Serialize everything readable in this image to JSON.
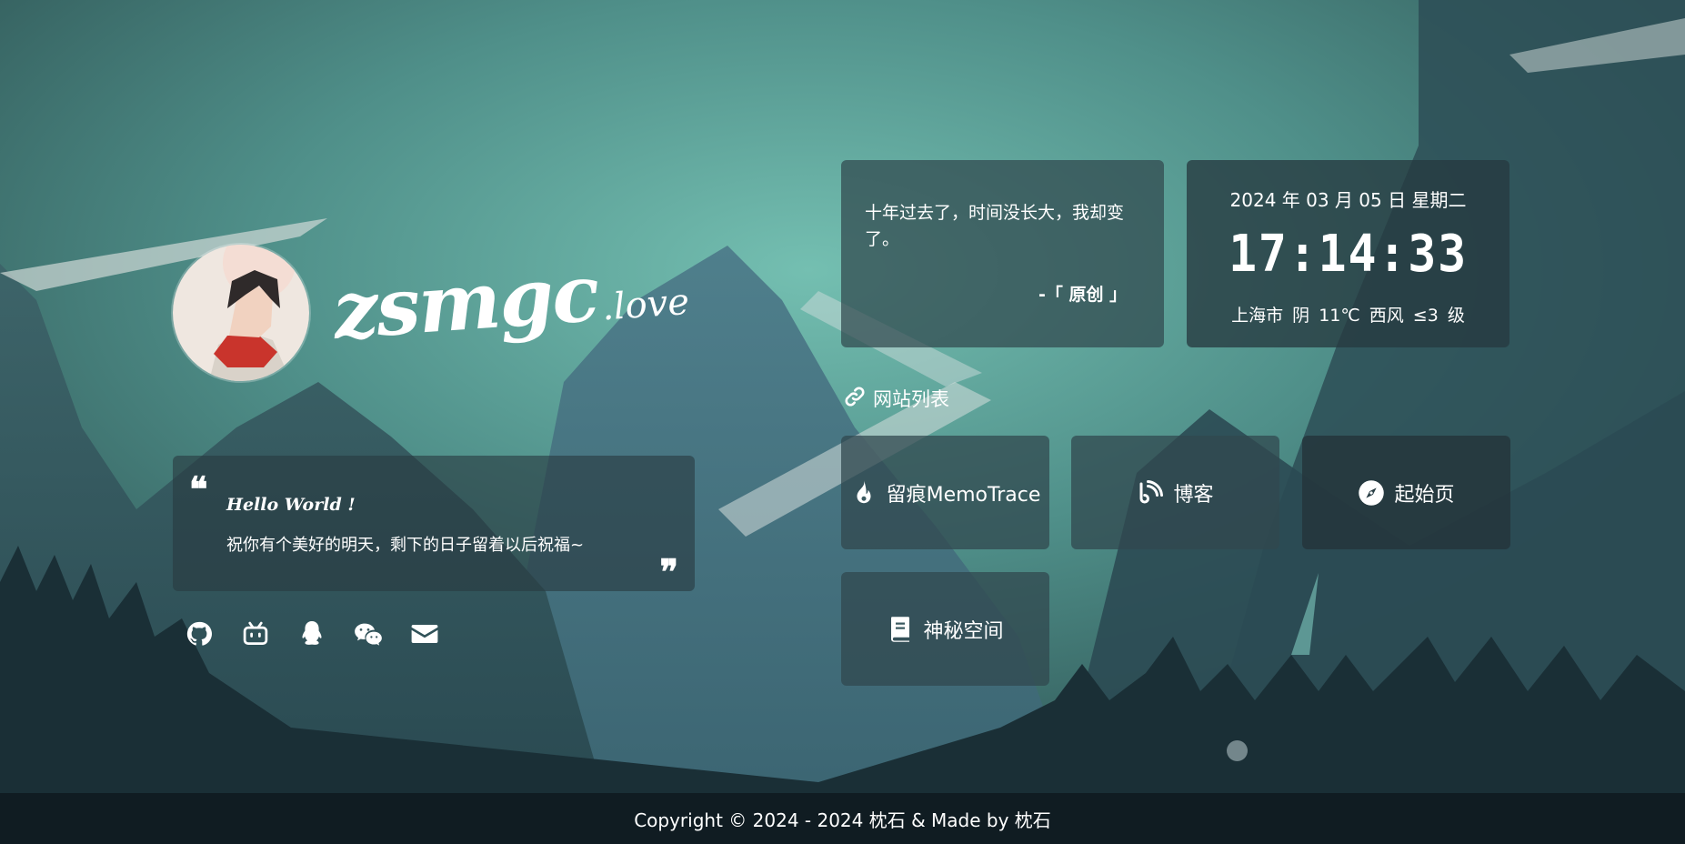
{
  "profile": {
    "logo_main": "zsmgc",
    "logo_sub": ".love"
  },
  "hello": {
    "title": "Hello World !",
    "text": "祝你有个美好的明天，剩下的日子留着以后祝福~",
    "quote_open": "❝",
    "quote_close": "❞"
  },
  "socials": [
    {
      "icon": "github-icon"
    },
    {
      "icon": "bilibili-icon"
    },
    {
      "icon": "qq-icon"
    },
    {
      "icon": "wechat-icon"
    },
    {
      "icon": "email-icon"
    }
  ],
  "quote": {
    "text": "十年过去了，时间没长大，我却变了。",
    "author": "-「 原创 」"
  },
  "datetime": {
    "date": "2024 年 03 月 05 日 星期二",
    "time": "17:14:33",
    "weather": "上海市 阴 11℃ 西风 ≤3 级"
  },
  "sites": {
    "title": "网站列表",
    "icon": "link-icon",
    "items": [
      {
        "label": "留痕MemoTrace",
        "icon": "fire-icon"
      },
      {
        "label": "博客",
        "icon": "blog-feed-icon"
      },
      {
        "label": "起始页",
        "icon": "compass-icon"
      },
      {
        "label": "神秘空间",
        "icon": "book-icon"
      }
    ]
  },
  "footer": {
    "text": "Copyright © 2024 - 2024 枕石 & Made by 枕石"
  },
  "colors": {
    "sky_top": "#3f6d6b",
    "sky_glow": "#6fb6aa",
    "mountain_far": "#4d7f86",
    "mountain_near": "#2f5560",
    "forest": "#1b3038",
    "card_bg": "#30484e"
  }
}
